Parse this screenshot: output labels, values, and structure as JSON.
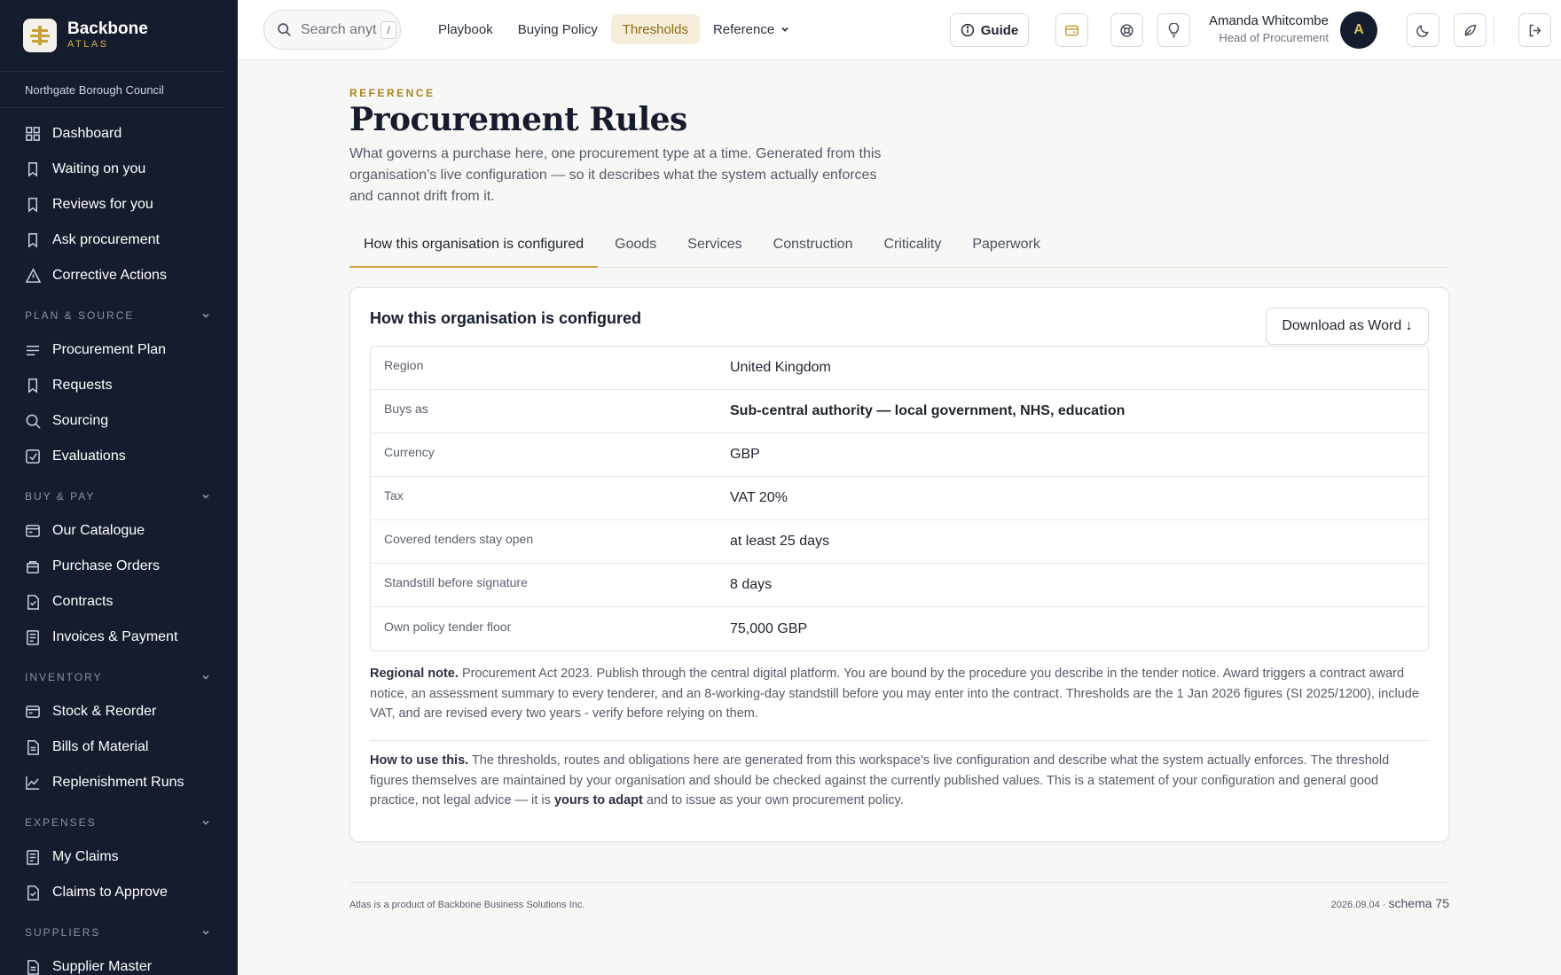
{
  "brand": {
    "name": "Backbone",
    "sub": "ATLAS"
  },
  "org": "Northgate Borough Council",
  "sidebar": {
    "top_items": [
      {
        "label": "Dashboard",
        "icon": "grid-icon"
      },
      {
        "label": "Waiting on you",
        "icon": "bookmark-icon"
      },
      {
        "label": "Reviews for you",
        "icon": "bookmark-icon"
      },
      {
        "label": "Ask procurement",
        "icon": "bookmark-icon"
      },
      {
        "label": "Corrective Actions",
        "icon": "warning-icon"
      }
    ],
    "sections": [
      {
        "title": "PLAN & SOURCE",
        "items": [
          {
            "label": "Procurement Plan",
            "icon": "list-icon"
          },
          {
            "label": "Requests",
            "icon": "bookmark-icon"
          },
          {
            "label": "Sourcing",
            "icon": "search-icon"
          },
          {
            "label": "Evaluations",
            "icon": "checkbox-icon"
          }
        ]
      },
      {
        "title": "BUY & PAY",
        "items": [
          {
            "label": "Our Catalogue",
            "icon": "card-icon"
          },
          {
            "label": "Purchase Orders",
            "icon": "bag-icon"
          },
          {
            "label": "Contracts",
            "icon": "document-check-icon"
          },
          {
            "label": "Invoices & Payment",
            "icon": "receipt-icon"
          }
        ]
      },
      {
        "title": "INVENTORY",
        "items": [
          {
            "label": "Stock & Reorder",
            "icon": "card-icon"
          },
          {
            "label": "Bills of Material",
            "icon": "document-icon"
          },
          {
            "label": "Replenishment Runs",
            "icon": "chart-line-icon"
          }
        ]
      },
      {
        "title": "EXPENSES",
        "items": [
          {
            "label": "My Claims",
            "icon": "receipt-icon"
          },
          {
            "label": "Claims to Approve",
            "icon": "document-check-icon"
          }
        ]
      },
      {
        "title": "SUPPLIERS",
        "items": [
          {
            "label": "Supplier Master",
            "icon": "document-icon"
          }
        ]
      }
    ]
  },
  "topbar": {
    "search_placeholder": "Search anything",
    "search_shortcut": "/",
    "nav": [
      {
        "label": "Playbook",
        "active": false
      },
      {
        "label": "Buying Policy",
        "active": false
      },
      {
        "label": "Thresholds",
        "active": true
      },
      {
        "label": "Reference",
        "active": false,
        "dropdown": true
      }
    ],
    "guide_label": "Guide",
    "user": {
      "name": "Amanda Whitcombe",
      "role": "Head of Procurement",
      "initial": "A"
    }
  },
  "page": {
    "eyebrow": "REFERENCE",
    "title": "Procurement Rules",
    "lead": "What governs a purchase here, one procurement type at a time. Generated from this organisation's live configuration — so it describes what the system actually enforces and cannot drift from it.",
    "tabs": [
      {
        "label": "How this organisation is configured",
        "active": true
      },
      {
        "label": "Goods",
        "active": false
      },
      {
        "label": "Services",
        "active": false
      },
      {
        "label": "Construction",
        "active": false
      },
      {
        "label": "Criticality",
        "active": false
      },
      {
        "label": "Paperwork",
        "active": false
      }
    ]
  },
  "card": {
    "title": "How this organisation is configured",
    "download_label": "Download as Word ↓",
    "rows": [
      {
        "key": "Region",
        "value": "United Kingdom",
        "bold": false
      },
      {
        "key": "Buys as",
        "value": "Sub-central authority — local government, NHS, education",
        "bold": true
      },
      {
        "key": "Currency",
        "value": "GBP",
        "bold": false
      },
      {
        "key": "Tax",
        "value": "VAT 20%",
        "bold": false
      },
      {
        "key": "Covered tenders stay open",
        "value": "at least 25 days",
        "bold": false
      },
      {
        "key": "Standstill before signature",
        "value": "8 days",
        "bold": false
      },
      {
        "key": "Own policy tender floor",
        "value": "75,000 GBP",
        "bold": false
      }
    ],
    "regional_note_label": "Regional note.",
    "regional_note": "Procurement Act 2023. Publish through the central digital platform. You are bound by the procedure you describe in the tender notice. Award triggers a contract award notice, an assessment summary to every tenderer, and an 8-working-day standstill before you may enter into the contract. Thresholds are the 1 Jan 2026 figures (SI 2025/1200), include VAT, and are revised every two years - verify before relying on them.",
    "howto_label": "How to use this.",
    "howto_text": "The thresholds, routes and obligations here are generated from this workspace's live configuration and describe what the system actually enforces. The threshold figures themselves are maintained by your organisation and should be checked against the currently published values. This is a statement of your configuration and general good practice, not legal advice — it is",
    "howto_bold": "yours to adapt",
    "howto_tail": "and to issue as your own procurement policy."
  },
  "footer": {
    "left": "Atlas is a product of Backbone Business Solutions Inc.",
    "version": "2026.09.04 ·",
    "schema": "schema 75"
  },
  "colors": {
    "sidebar_bg": "#141c2e",
    "accent_gold": "#c9a13b",
    "active_nav_bg": "#f6eeda"
  }
}
